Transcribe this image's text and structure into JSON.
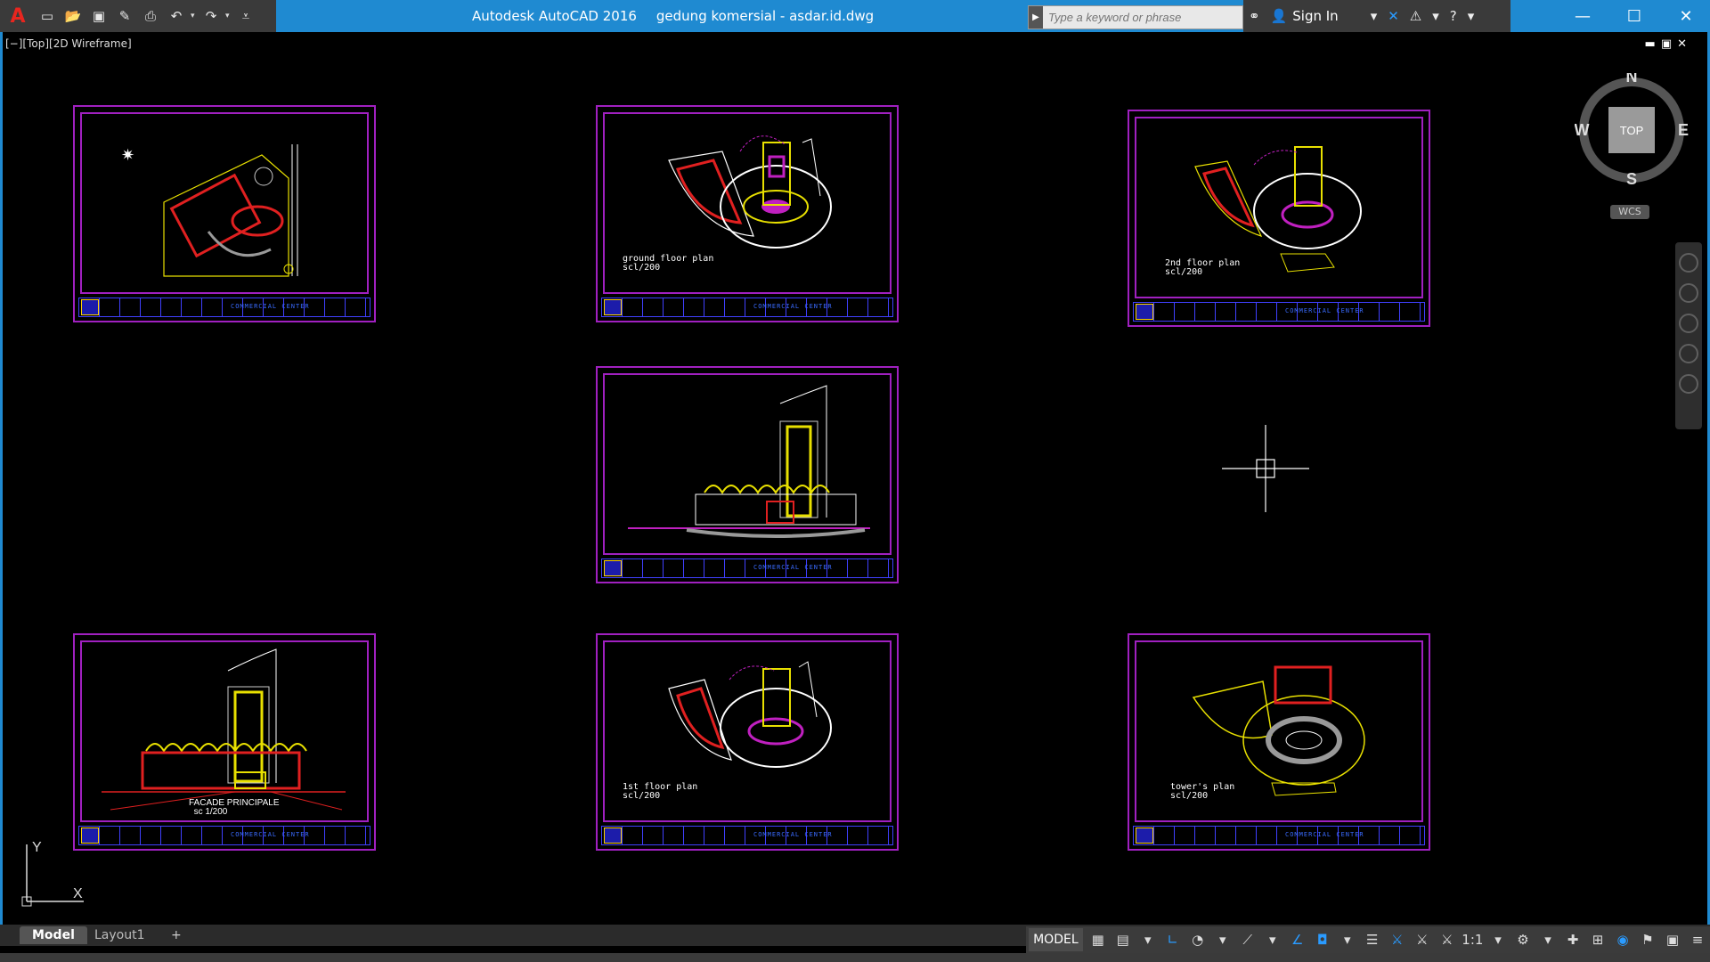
{
  "app": {
    "title": "Autodesk AutoCAD 2016",
    "document": "gedung komersial - asdar.id.dwg",
    "logo": "A",
    "colors": {
      "accent": "#1f8ad1",
      "sheet_border": "#a020c0",
      "titleblock": "#4040ff",
      "red": "#e02020",
      "yellow": "#e8e000",
      "white": "#ffffff"
    }
  },
  "search": {
    "placeholder": "Type a keyword or phrase"
  },
  "account": {
    "sign_in": "Sign In"
  },
  "viewport": {
    "label": "[−][Top][2D Wireframe]"
  },
  "view_cube": {
    "top": "TOP",
    "n": "N",
    "s": "S",
    "e": "E",
    "w": "W",
    "wcs": "WCS"
  },
  "sheets": [
    {
      "name": "site-plan",
      "label": "",
      "scale": ""
    },
    {
      "name": "ground-floor-plan",
      "label": "ground floor plan",
      "scale": "scl/200"
    },
    {
      "name": "2nd-floor-plan",
      "label": "2nd floor plan",
      "scale": "scl/200"
    },
    {
      "name": "side-elevation",
      "label": "",
      "scale": ""
    },
    {
      "name": "facade-principale",
      "label": "FACADE PRINCIPALE",
      "scale": "sc 1/200"
    },
    {
      "name": "1st-floor-plan",
      "label": "1st floor plan",
      "scale": "scl/200"
    },
    {
      "name": "towers-plan",
      "label": "tower's plan",
      "scale": "scl/200"
    }
  ],
  "titleblock_text": "COMMERCIAL CENTER",
  "ucs": {
    "x": "X",
    "y": "Y"
  },
  "tabs": {
    "model": "Model",
    "layout1": "Layout1",
    "add": "+"
  },
  "status": {
    "model": "MODEL",
    "scale": "1:1"
  }
}
